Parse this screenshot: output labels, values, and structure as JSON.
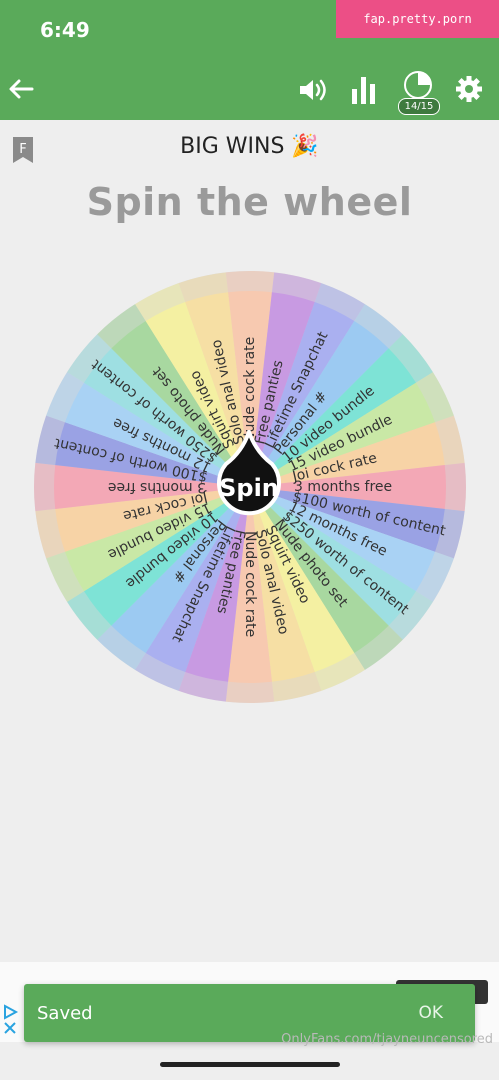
{
  "status_bar": {
    "time": "6:49",
    "url_badge": "fap.pretty.porn"
  },
  "toolbar": {
    "back_icon": "back-arrow-icon",
    "volume_icon": "volume-icon",
    "stats_icon": "bar-chart-icon",
    "round_icon": "pie-progress-icon",
    "round_count": "14/15",
    "settings_icon": "gear-icon"
  },
  "header": {
    "bookmark_icon": "bookmark-f-icon",
    "big_wins": "BIG WINS 🎉",
    "title": "Spin the wheel"
  },
  "wheel": {
    "spin_label": "Spin",
    "segments": [
      {
        "label": "Nude cock rate",
        "color": "#f7c9b0"
      },
      {
        "label": "Free panties",
        "color": "#c89ae2"
      },
      {
        "label": "Lifetime Snapchat",
        "color": "#aab0f0"
      },
      {
        "label": "Personal #",
        "color": "#9ccaf2"
      },
      {
        "label": "10 video bundle",
        "color": "#7ee3d6"
      },
      {
        "label": "15 video bundle",
        "color": "#c9e8a6"
      },
      {
        "label": "Joi cock rate",
        "color": "#f7d3a6"
      },
      {
        "label": "3 months free",
        "color": "#f3a8b6"
      },
      {
        "label": "$100 worth of content",
        "color": "#9aa2e4"
      },
      {
        "label": "12 months free",
        "color": "#a9d2f4"
      },
      {
        "label": "$250 worth of content",
        "color": "#9edfe2"
      },
      {
        "label": "Nude photo set",
        "color": "#a8d8a0"
      },
      {
        "label": "Squirt video",
        "color": "#f4f0a2"
      },
      {
        "label": "Solo anal video",
        "color": "#f6dfa4"
      },
      {
        "label": "Nude cock rate",
        "color": "#f7c9b0"
      },
      {
        "label": "Free panties",
        "color": "#c89ae2"
      },
      {
        "label": "Lifetime Snapchat",
        "color": "#aab0f0"
      },
      {
        "label": "Personal #",
        "color": "#9ccaf2"
      },
      {
        "label": "10 video bundle",
        "color": "#7ee3d6"
      },
      {
        "label": "15 video bundle",
        "color": "#c9e8a6"
      },
      {
        "label": "Joi cock rate",
        "color": "#f7d3a6"
      },
      {
        "label": "3 months free",
        "color": "#f3a8b6"
      },
      {
        "label": "$100 worth of content",
        "color": "#9aa2e4"
      },
      {
        "label": "12 months free",
        "color": "#a9d2f4"
      },
      {
        "label": "$250 worth of content",
        "color": "#9edfe2"
      },
      {
        "label": "Nude photo set",
        "color": "#a8d8a0"
      },
      {
        "label": "Squirt video",
        "color": "#f4f0a2"
      },
      {
        "label": "Solo anal video",
        "color": "#f6dfa4"
      }
    ]
  },
  "snackbar": {
    "message": "Saved",
    "action": "OK"
  },
  "watermark": "OnlyFans.com/tjayneuncensored",
  "colors": {
    "app_green": "#5aaa5a",
    "badge_pink": "#ec4f86",
    "title_gray": "#9a9a9a"
  }
}
